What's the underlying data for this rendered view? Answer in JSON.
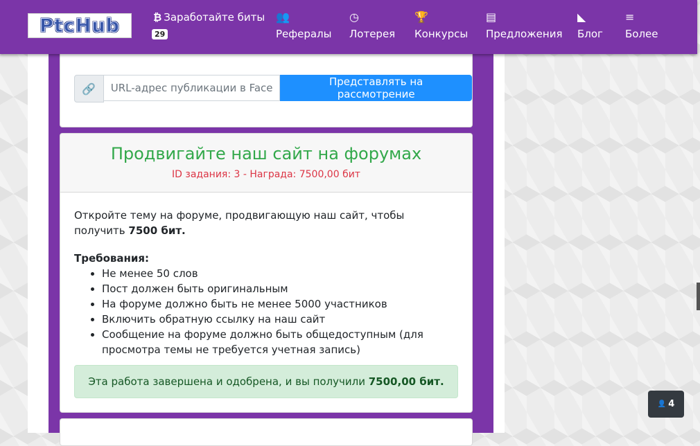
{
  "brand": {
    "logo_text": "PtcHub"
  },
  "nav": {
    "earn": {
      "icon": "₿",
      "label": "Заработайте биты",
      "badge": "29"
    },
    "items": [
      {
        "icon": "users-icon",
        "glyph": "👥",
        "label": "Рефералы"
      },
      {
        "icon": "clock-icon",
        "glyph": "◷",
        "label": "Лотерея"
      },
      {
        "icon": "trophy-icon",
        "glyph": "🏆",
        "label": "Конкурсы"
      },
      {
        "icon": "list-icon",
        "glyph": "▤",
        "label": "Предложения"
      },
      {
        "icon": "rss-icon",
        "glyph": "◣",
        "label": "Блог"
      },
      {
        "icon": "menu-icon",
        "glyph": "≡",
        "label": "Более"
      }
    ]
  },
  "submit_form": {
    "link_icon": "🔗",
    "placeholder": "URL-адрес публикации в Facebook",
    "submit_label": "Представлять на рассмотрение"
  },
  "task": {
    "title": "Продвигайте наш сайт на форумах",
    "subtitle": "ID задания: 3 - Награда: 7500,00 бит",
    "description_prefix": "Откройте тему на форуме, продвигающую наш сайт, чтобы получить ",
    "description_bold": "7500 бит.",
    "requirements_title": "Требования:",
    "requirements": [
      "Не менее 50 слов",
      "Пост должен быть оригинальным",
      "На форуме должно быть не менее 5000 участников",
      "Включить обратную ссылку на наш сайт",
      "Сообщение на форуме должно быть общедоступным (для просмотра темы не требуется учетная запись)"
    ],
    "status_prefix": "Эта работа завершена и одобрена, и вы получили ",
    "status_bold": "7500,00 бит."
  },
  "online_users": {
    "icon": "user-icon",
    "glyph": "👤",
    "count": "4"
  },
  "colors": {
    "brand": "#7b35a8",
    "primary": "#1e90ff",
    "success": "#32a84a",
    "danger": "#dc3545"
  }
}
